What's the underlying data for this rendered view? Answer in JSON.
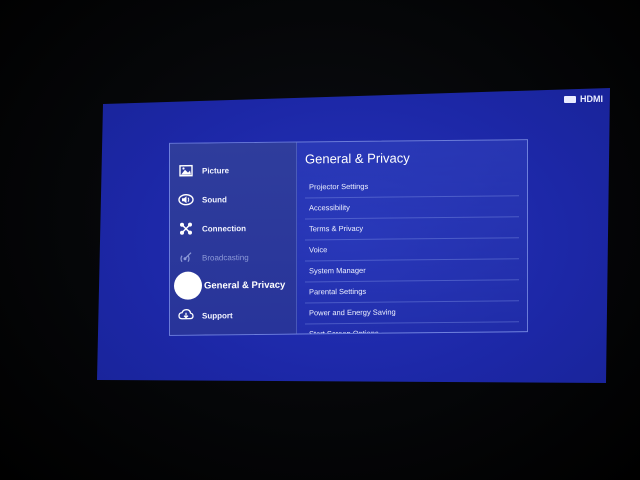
{
  "source_badge": {
    "icon": "hdmi-source-icon",
    "label": "HDMI"
  },
  "sidebar": {
    "items": [
      {
        "label": "Picture",
        "icon": "picture-icon",
        "state": "normal"
      },
      {
        "label": "Sound",
        "icon": "sound-icon",
        "state": "normal"
      },
      {
        "label": "Connection",
        "icon": "connection-icon",
        "state": "normal"
      },
      {
        "label": "Broadcasting",
        "icon": "broadcasting-icon",
        "state": "disabled"
      },
      {
        "label": "General & Privacy",
        "icon": "focus-dot",
        "state": "selected"
      },
      {
        "label": "Support",
        "icon": "support-icon",
        "state": "normal"
      }
    ]
  },
  "content": {
    "title": "General & Privacy",
    "options": [
      "Projector Settings",
      "Accessibility",
      "Terms & Privacy",
      "Voice",
      "System Manager",
      "Parental Settings",
      "Power and Energy Saving",
      "Start Screen Options"
    ]
  },
  "colors": {
    "screen_blue": "#1c27a6",
    "sidebar_blue": "#2f3d9c",
    "text": "#ffffff"
  }
}
